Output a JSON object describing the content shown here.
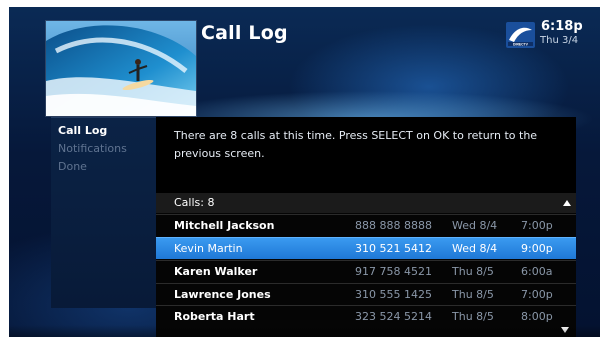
{
  "header": {
    "title": "Call Log",
    "time": "6:18p",
    "date": "Thu 3/4",
    "logo_icon": "directv-logo-icon",
    "thumbnail": "surfer-wave-image"
  },
  "sidebar": {
    "items": [
      {
        "label": "Call Log",
        "active": true
      },
      {
        "label": "Notifications",
        "active": false
      },
      {
        "label": "Done",
        "active": false
      }
    ]
  },
  "message": "There are 8 calls at this time. Press SELECT on OK to return to the previous screen.",
  "calls": {
    "header_label": "Calls: 8",
    "rows": [
      {
        "name": "Mitchell Jackson",
        "number": "888 888 8888",
        "day": "Wed 8/4",
        "time": "7:00p",
        "selected": false
      },
      {
        "name": "Kevin Martin",
        "number": "310 521 5412",
        "day": "Wed 8/4",
        "time": "9:00p",
        "selected": true
      },
      {
        "name": "Karen Walker",
        "number": "917 758 4521",
        "day": "Thu 8/5",
        "time": "6:00a",
        "selected": false
      },
      {
        "name": "Lawrence Jones",
        "number": "310 555 1425",
        "day": "Thu 8/5",
        "time": "7:00p",
        "selected": false
      },
      {
        "name": "Roberta Hart",
        "number": "323 524 5214",
        "day": "Thu 8/5",
        "time": "8:00p",
        "selected": false
      }
    ]
  },
  "colors": {
    "selection": "#1f78d6",
    "background": "#06183a",
    "accent": "#3a9af0"
  }
}
